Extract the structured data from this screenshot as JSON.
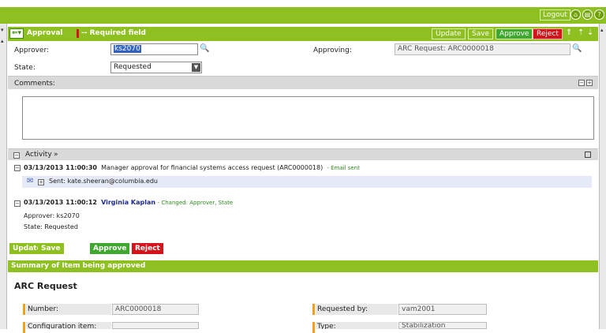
{
  "topbar": {
    "logout_label": "Logout",
    "icons": [
      "home-icon",
      "print-icon",
      "help-icon"
    ]
  },
  "form_header": {
    "title": "Approval",
    "required_note": "-- Required field",
    "buttons": {
      "update": "Update",
      "save": "Save",
      "approve": "Approve",
      "reject": "Reject"
    }
  },
  "fields": {
    "approver": {
      "label": "Approver:",
      "value": "ks2070"
    },
    "approving": {
      "label": "Approving:",
      "value": "ARC Request: ARC0000018"
    },
    "state": {
      "label": "State:",
      "value": "Requested"
    },
    "comments": {
      "label": "Comments:",
      "value": ""
    }
  },
  "activity": {
    "label": "Activity",
    "entries": [
      {
        "timestamp": "03/13/2013 11:00:30",
        "text": "Manager approval for financial systems access request (ARC0000018)",
        "note": "- Email sent",
        "sent": "Sent: kate.sheeran@columbia.edu"
      },
      {
        "timestamp": "03/13/2013 11:00:12",
        "user": "Virginia Kaplan",
        "note": "- Changed: Approver, State",
        "line1": "Approver: ks2070",
        "line2": "State: Requested"
      }
    ]
  },
  "bottom_buttons": {
    "update": "Update",
    "save": "Save",
    "approve": "Approve",
    "reject": "Reject"
  },
  "summary": {
    "bar_title": "Summary of Item being approved",
    "heading": "ARC Request",
    "number": {
      "label": "Number:",
      "value": "ARC0000018"
    },
    "requested_by": {
      "label": "Requested by:",
      "value": "vam2001"
    },
    "configuration_item": {
      "label": "Configuration item:",
      "value": ""
    },
    "type": {
      "label": "Type:",
      "value": "Stabilization"
    }
  },
  "colors": {
    "brand_green": "#8dc020",
    "approve_green": "#3fa82e",
    "reject_red": "#d4141a",
    "required_mark": "#f0a018"
  }
}
